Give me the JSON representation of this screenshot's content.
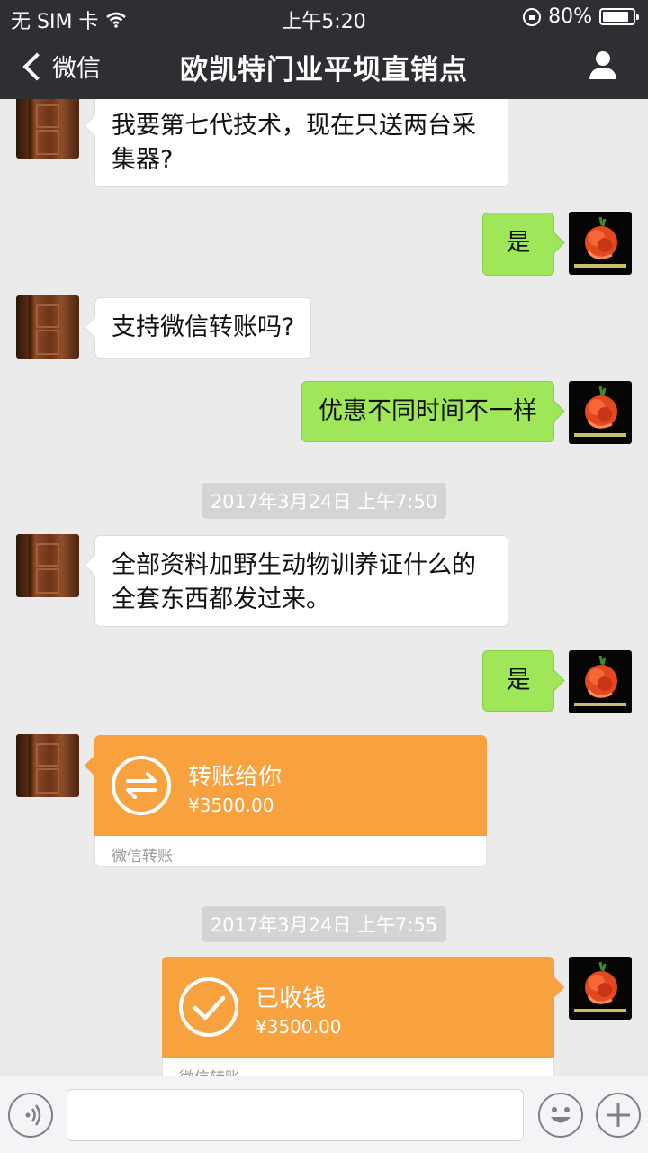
{
  "status_bar": {
    "carrier": "无 SIM 卡",
    "time": "上午5:20",
    "battery": "80%"
  },
  "nav": {
    "back_label": "微信",
    "title": "欧凯特门业平坝直销点"
  },
  "messages": [
    {
      "side": "left",
      "kind": "text",
      "text": "我要第七代技术，现在只送两台采集器?"
    },
    {
      "side": "right",
      "kind": "text",
      "text": "是"
    },
    {
      "side": "left",
      "kind": "text",
      "text": "支持微信转账吗?"
    },
    {
      "side": "right",
      "kind": "text",
      "text": "优惠不同时间不一样"
    },
    {
      "kind": "timestamp",
      "text": "2017年3月24日 上午7:50"
    },
    {
      "side": "left",
      "kind": "text",
      "text": "全部资料加野生动物训养证什么的全套东西都发过来。"
    },
    {
      "side": "right",
      "kind": "text",
      "text": "是"
    },
    {
      "side": "left",
      "kind": "transfer",
      "title": "转账给你",
      "amount": "¥3500.00",
      "footer": "微信转账"
    },
    {
      "kind": "timestamp",
      "text": "2017年3月24日 上午7:55"
    },
    {
      "side": "right",
      "kind": "transfer",
      "title": "已收钱",
      "amount": "¥3500.00",
      "footer": "微信转账"
    }
  ],
  "colors": {
    "nav_bg": "#2f2f33",
    "chat_bg": "#ebebeb",
    "sent_bubble": "#9fe658",
    "transfer_orange": "#f8a13f"
  },
  "icons": {
    "wifi": "wifi-icon",
    "lock": "rotation-lock-icon",
    "battery": "battery-icon",
    "back": "chevron-left-icon",
    "contact": "person-icon",
    "voice": "voice-icon",
    "emoji": "emoji-icon",
    "add": "plus-icon",
    "transfer": "transfer-arrows-icon",
    "received": "checkmark-icon"
  }
}
